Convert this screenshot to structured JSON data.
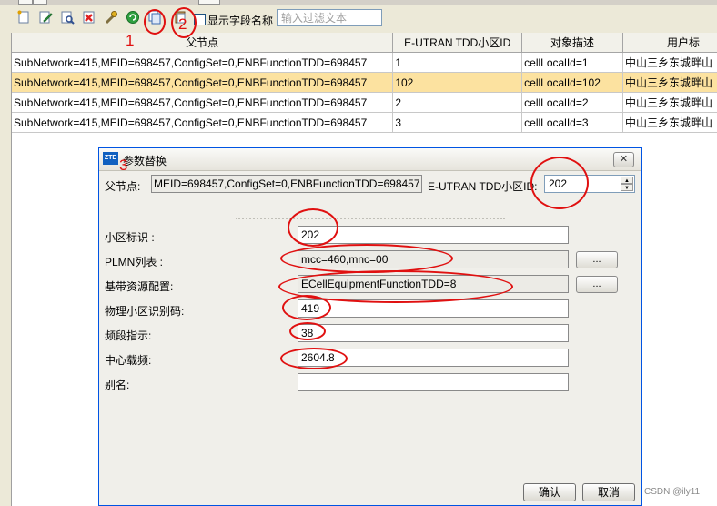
{
  "toolbar": {
    "show_field_names_label": "显示字段名称",
    "filter_placeholder": "输入过滤文本"
  },
  "table": {
    "columns": [
      "父节点",
      "E-UTRAN TDD小区ID",
      "对象描述",
      "用户标"
    ],
    "rows": [
      [
        "SubNetwork=415,MEID=698457,ConfigSet=0,ENBFunctionTDD=698457",
        "1",
        "cellLocalId=1",
        "中山三乡东城畔山"
      ],
      [
        "SubNetwork=415,MEID=698457,ConfigSet=0,ENBFunctionTDD=698457",
        "102",
        "cellLocalId=102",
        "中山三乡东城畔山"
      ],
      [
        "SubNetwork=415,MEID=698457,ConfigSet=0,ENBFunctionTDD=698457",
        "2",
        "cellLocalId=2",
        "中山三乡东城畔山"
      ],
      [
        "SubNetwork=415,MEID=698457,ConfigSet=0,ENBFunctionTDD=698457",
        "3",
        "cellLocalId=3",
        "中山三乡东城畔山"
      ]
    ],
    "selected_row_index": 1
  },
  "dialog": {
    "logo": "ZTE",
    "title": "参数替换",
    "close": "✕",
    "parent_label": "父节点:",
    "parent_value": "MEID=698457,ConfigSet=0,ENBFunctionTDD=698457",
    "cell_id_label": "E-UTRAN TDD小区ID:",
    "cell_id_value": "202",
    "fields": [
      {
        "label": "小区标识 :",
        "value": "202"
      },
      {
        "label": "PLMN列表 :",
        "value": "mcc=460,mnc=00",
        "button": "..."
      },
      {
        "label": "基带资源配置:",
        "value": "ECellEquipmentFunctionTDD=8",
        "button": "..."
      },
      {
        "label": "物理小区识别码:",
        "value": "419"
      },
      {
        "label": "频段指示:",
        "value": "38"
      },
      {
        "label": "中心载频:",
        "value": "2604.8"
      },
      {
        "label": "别名:",
        "value": ""
      }
    ],
    "ok": "确认",
    "cancel": "取消"
  },
  "annotations": {
    "n1": "1",
    "n2": "2",
    "n3": "3",
    "color": "#e01010"
  },
  "watermark": "CSDN @ily11",
  "icons": [
    "new-icon",
    "edit-icon",
    "view-icon",
    "delete-icon",
    "wrench-icon",
    "refresh-icon",
    "copy-icon",
    "paste-icon"
  ]
}
